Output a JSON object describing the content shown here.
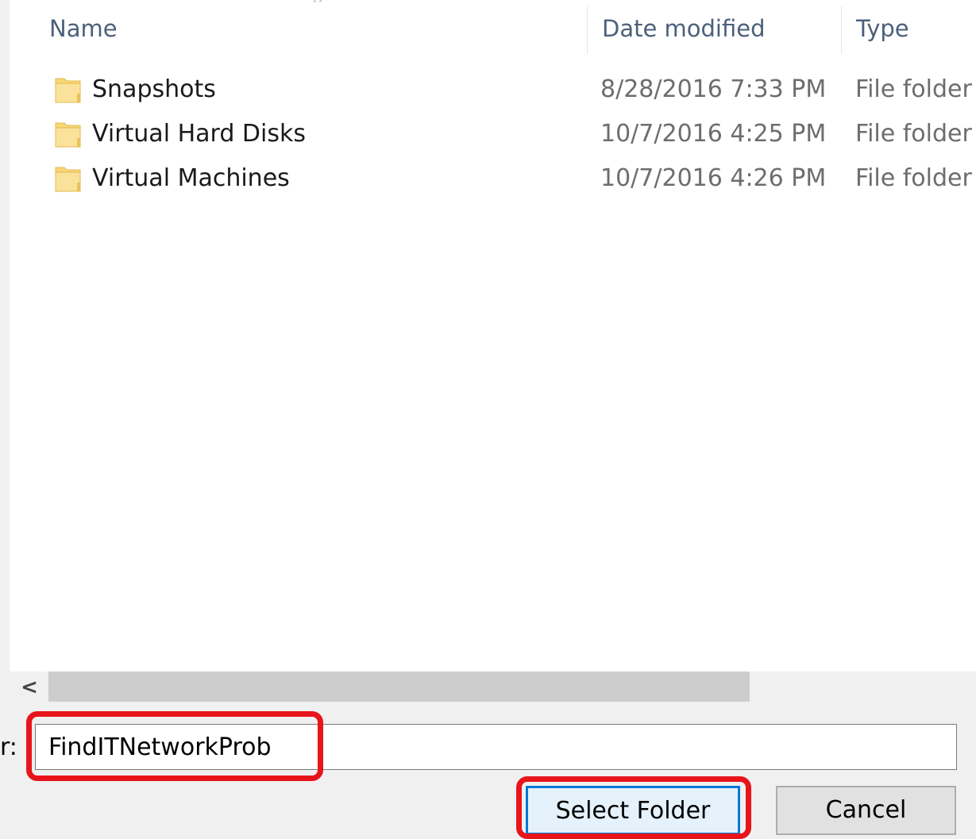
{
  "columns": {
    "name": "Name",
    "date_modified": "Date modified",
    "type": "Type"
  },
  "files": [
    {
      "name": "Snapshots",
      "date_modified": "8/28/2016 7:33 PM",
      "type": "File folder",
      "icon": "folder-icon"
    },
    {
      "name": "Virtual Hard Disks",
      "date_modified": "10/7/2016 4:25 PM",
      "type": "File folder",
      "icon": "folder-icon"
    },
    {
      "name": "Virtual Machines",
      "date_modified": "10/7/2016 4:26 PM",
      "type": "File folder",
      "icon": "folder-icon"
    }
  ],
  "scrollbar": {
    "left_arrow": "<"
  },
  "folder_field": {
    "label_fragment": "r:",
    "value": "FindITNetworkProb"
  },
  "buttons": {
    "select_folder": "Select Folder",
    "cancel": "Cancel"
  },
  "colors": {
    "highlight": "#e8141b",
    "default_button_border": "#0078d7",
    "folder": "#f8d775"
  }
}
